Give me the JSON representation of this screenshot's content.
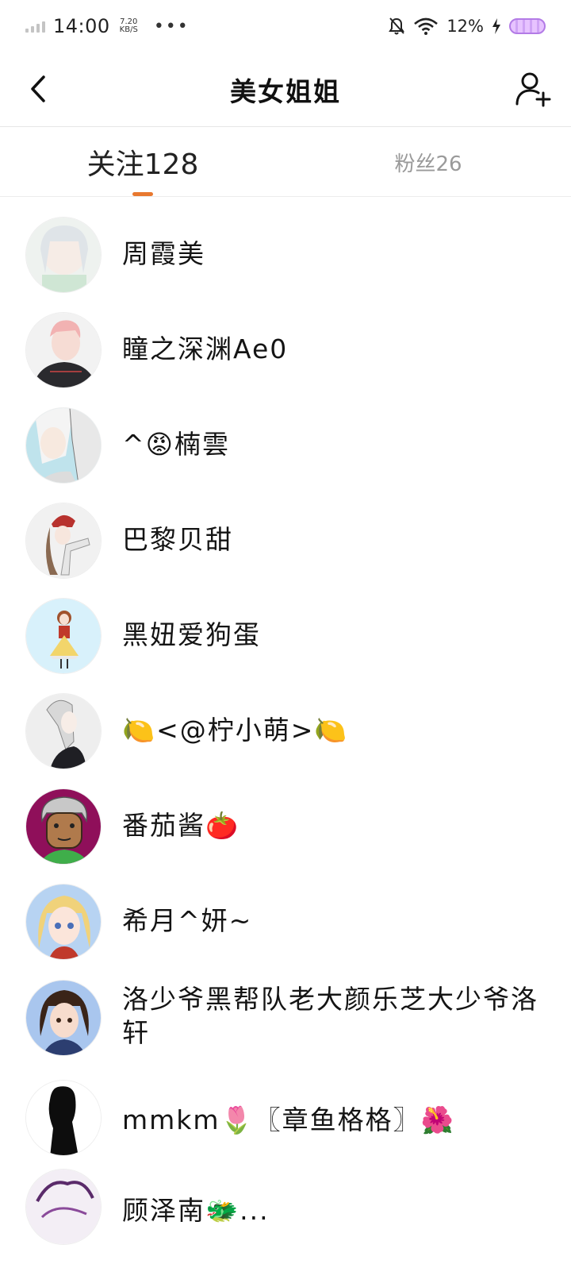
{
  "status_bar": {
    "time": "14:00",
    "speed_value": "7.20",
    "speed_unit": "KB/S",
    "more": "•••",
    "battery": "12%"
  },
  "header": {
    "title": "美女姐姐"
  },
  "tabs": {
    "following": "关注128",
    "followers": "粉丝26"
  },
  "users": [
    {
      "name": "周霞美"
    },
    {
      "name": "瞳之深渊Ae0"
    },
    {
      "name": "^😡楠雲"
    },
    {
      "name": "巴黎贝甜"
    },
    {
      "name": "黑妞爱狗蛋"
    },
    {
      "name": "🍋<@柠小萌>🍋"
    },
    {
      "name": "番茄酱🍅"
    },
    {
      "name": "希月^妍~"
    },
    {
      "name": "洛少爷黑帮队老大颜乐芝大少爷洛轩"
    },
    {
      "name": "mmkm🌷〖章鱼格格〗🌺"
    },
    {
      "name": "顾泽南🐲..."
    }
  ],
  "colors": {
    "accent": "#e8782f",
    "tab_inactive": "#9a9a9a"
  }
}
